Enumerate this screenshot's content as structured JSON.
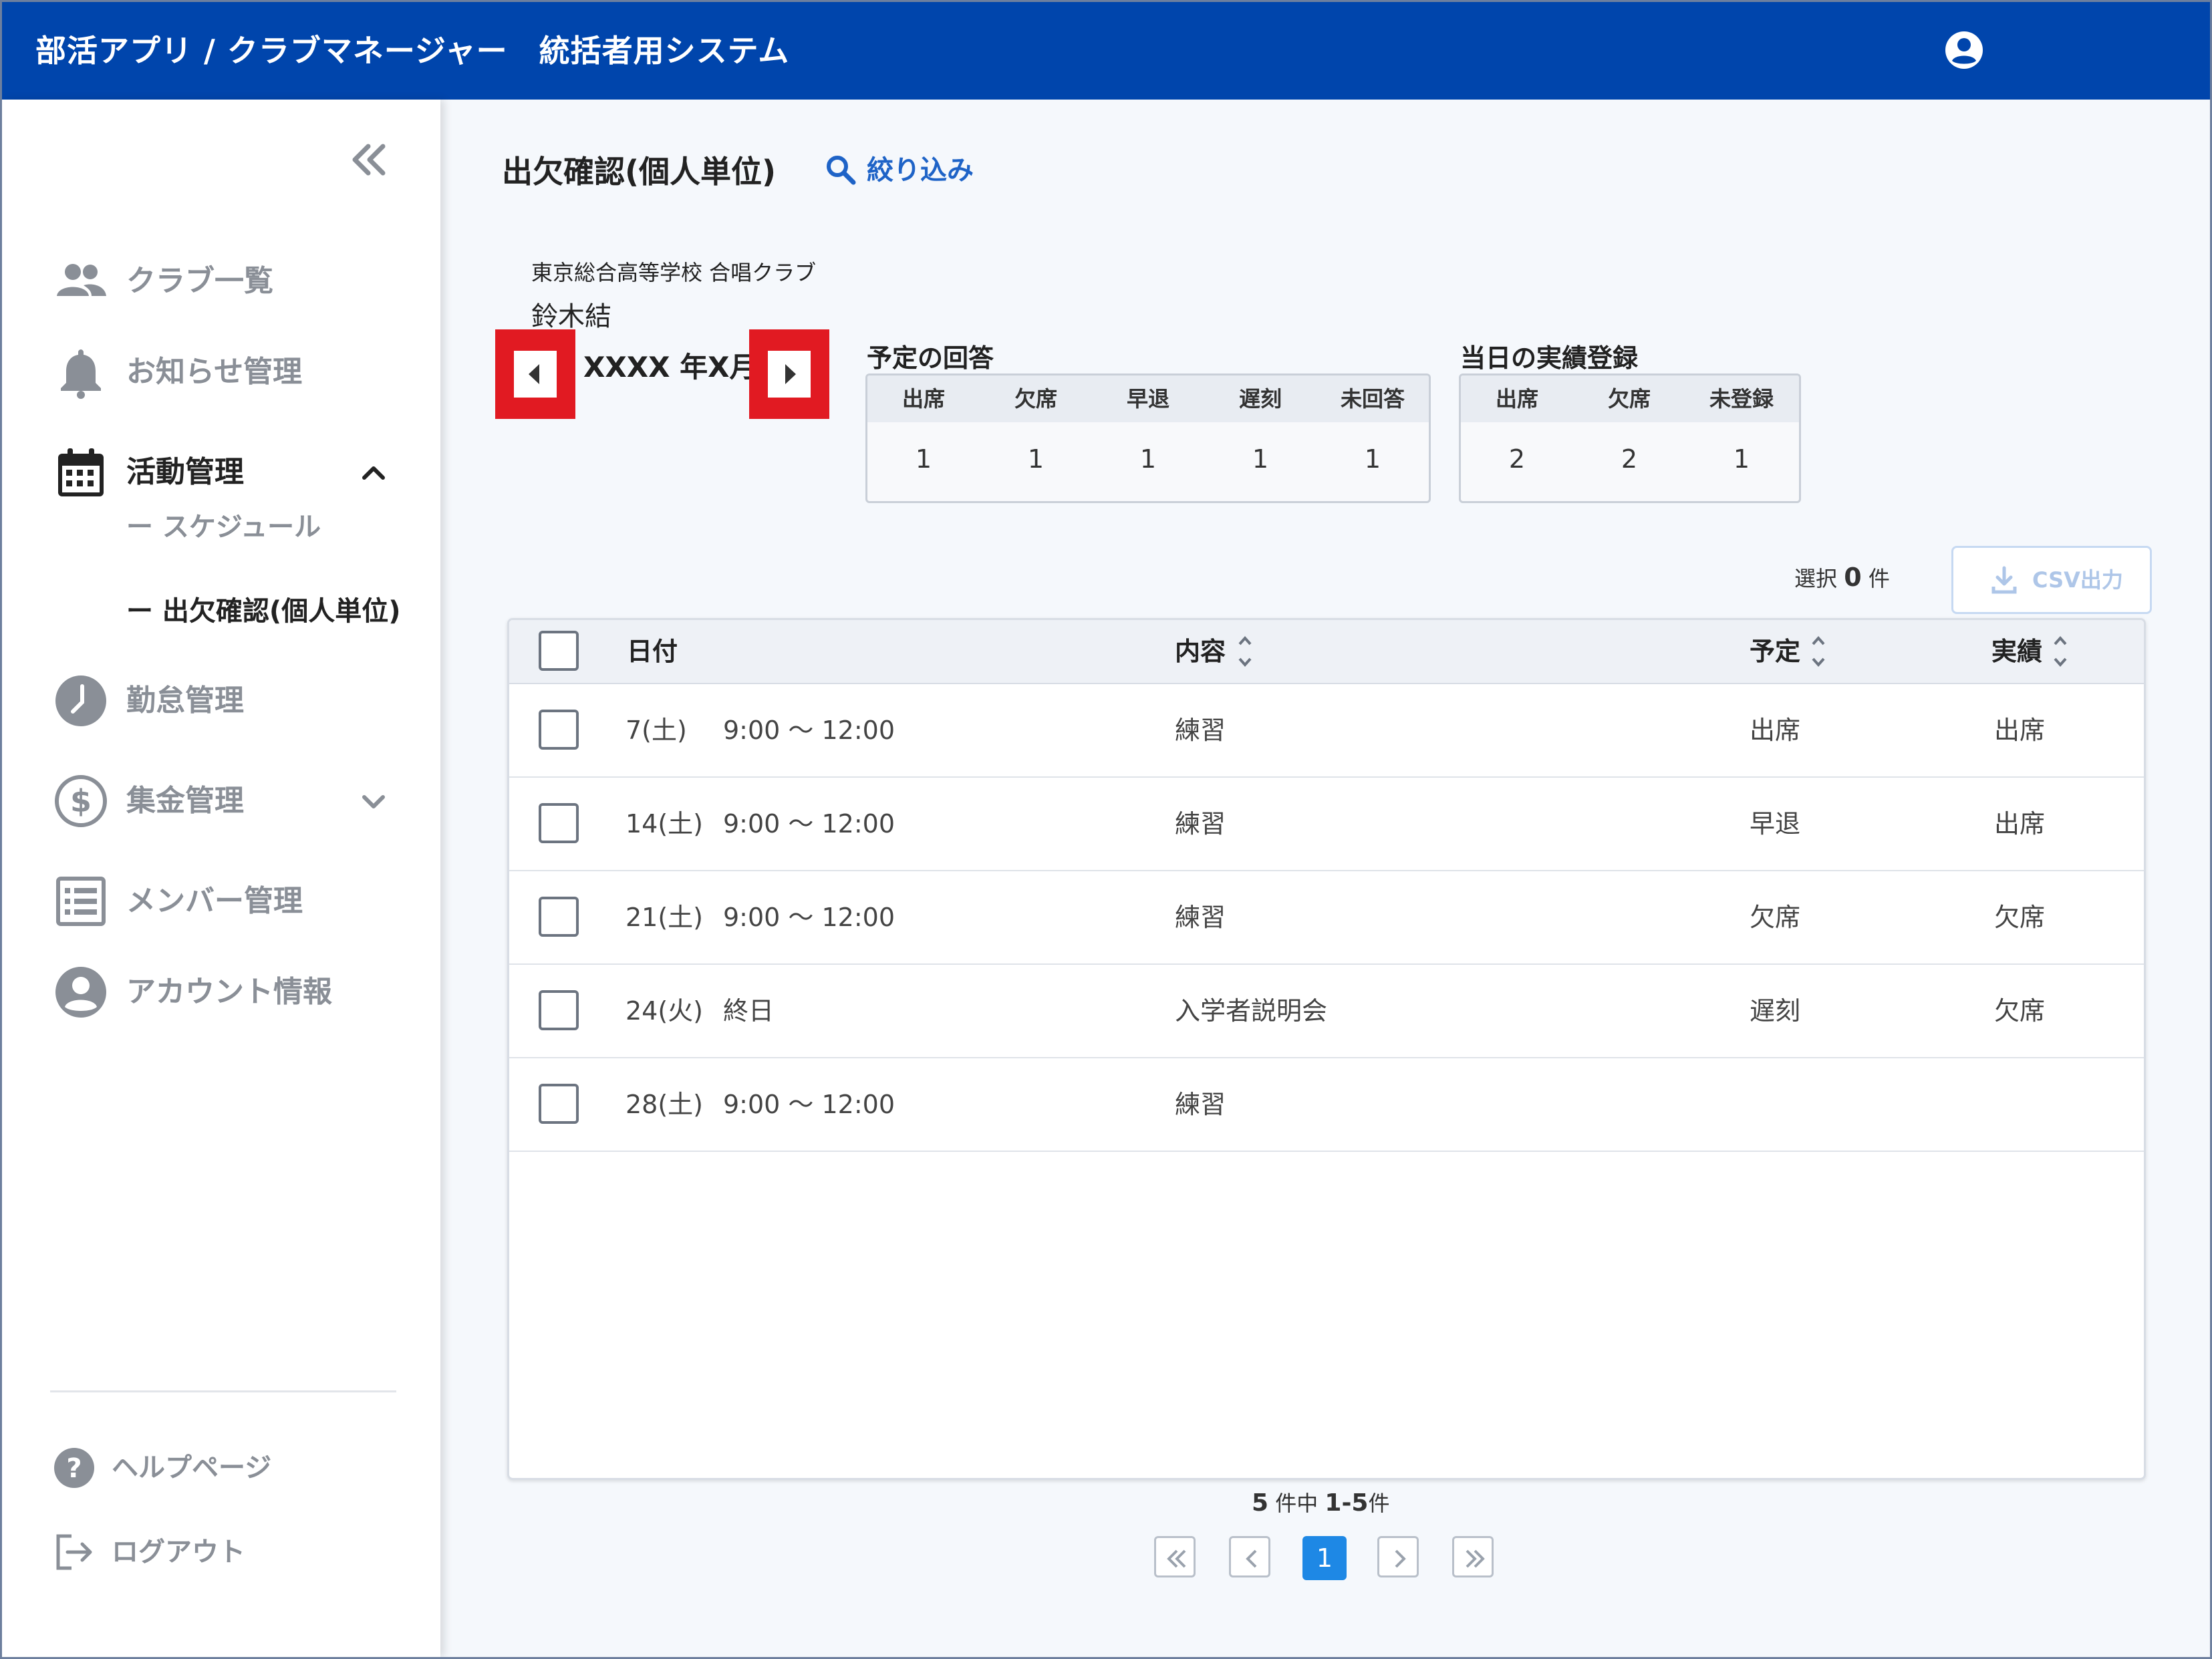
{
  "header": {
    "title": "部活アプリ / クラブマネージャー　統括者用システム"
  },
  "sidebar": {
    "items": [
      {
        "label": "クラブ一覧"
      },
      {
        "label": "お知らせ管理"
      },
      {
        "label": "活動管理"
      },
      {
        "label": "勤怠管理"
      },
      {
        "label": "集金管理"
      },
      {
        "label": "メンバー管理"
      },
      {
        "label": "アカウント情報"
      }
    ],
    "sub_items": [
      {
        "label": "ー スケジュール"
      },
      {
        "label": "ー 出欠確認(個人単位)"
      }
    ],
    "footer": [
      {
        "label": "ヘルプページ"
      },
      {
        "label": "ログアウト"
      }
    ]
  },
  "main": {
    "title": "出欠確認(個人単位)",
    "filter_label": "絞り込み",
    "school": "東京総合高等学校 合唱クラブ",
    "member": "鈴木結",
    "month": "XXXX 年X月",
    "plan_summary": {
      "title": "予定の回答",
      "headers": [
        "出席",
        "欠席",
        "早退",
        "遅刻",
        "未回答"
      ],
      "values": [
        "1",
        "1",
        "1",
        "1",
        "1"
      ]
    },
    "actual_summary": {
      "title": "当日の実績登録",
      "headers": [
        "出席",
        "欠席",
        "未登録"
      ],
      "values": [
        "2",
        "2",
        "1"
      ]
    },
    "selection": {
      "prefix": "選択",
      "count": "0",
      "suffix": "件"
    },
    "csv_label": "CSV出力",
    "table": {
      "headers": [
        "日付",
        "内容",
        "予定",
        "実績"
      ],
      "rows": [
        {
          "date": "7(土)",
          "time": "9:00 〜 12:00",
          "content": "練習",
          "plan": "出席",
          "actual": "出席"
        },
        {
          "date": "14(土)",
          "time": "9:00 〜 12:00",
          "content": "練習",
          "plan": "早退",
          "actual": "出席"
        },
        {
          "date": "21(土)",
          "time": "9:00 〜 12:00",
          "content": "練習",
          "plan": "欠席",
          "actual": "欠席"
        },
        {
          "date": "24(火)",
          "time": "終日",
          "content": "入学者説明会",
          "plan": "遅刻",
          "actual": "欠席"
        },
        {
          "date": "28(土)",
          "time": "9:00 〜 12:00",
          "content": "練習",
          "plan": "",
          "actual": ""
        }
      ]
    },
    "pagination": {
      "total": "5",
      "of": "件中",
      "range": "1-5",
      "unit": "件",
      "current": "1"
    }
  },
  "colors": {
    "header": "#0045ac",
    "accent": "#1e88e5",
    "highlight": "#e11a22"
  }
}
